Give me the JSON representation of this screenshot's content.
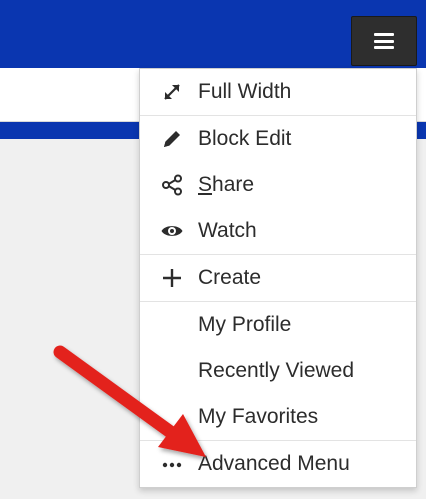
{
  "menu": {
    "groups": [
      {
        "items": [
          {
            "label": "Full Width",
            "icon": "expand-icon"
          }
        ]
      },
      {
        "items": [
          {
            "label": "Block Edit",
            "icon": "pencil-icon"
          },
          {
            "label_underlined": "S",
            "label_rest": "hare",
            "icon": "share-icon"
          },
          {
            "label": "Watch",
            "icon": "eye-icon"
          }
        ]
      },
      {
        "items": [
          {
            "label": "Create",
            "icon": "plus-icon"
          }
        ]
      },
      {
        "items": [
          {
            "label": "My Profile"
          },
          {
            "label": "Recently Viewed"
          },
          {
            "label": "My Favorites"
          }
        ]
      },
      {
        "items": [
          {
            "label": "Advanced Menu",
            "icon": "ellipsis-icon"
          }
        ]
      }
    ]
  },
  "colors": {
    "header_blue": "#0a36b0",
    "button_dark": "#2e2e2e",
    "arrow_red": "#e3201c"
  }
}
